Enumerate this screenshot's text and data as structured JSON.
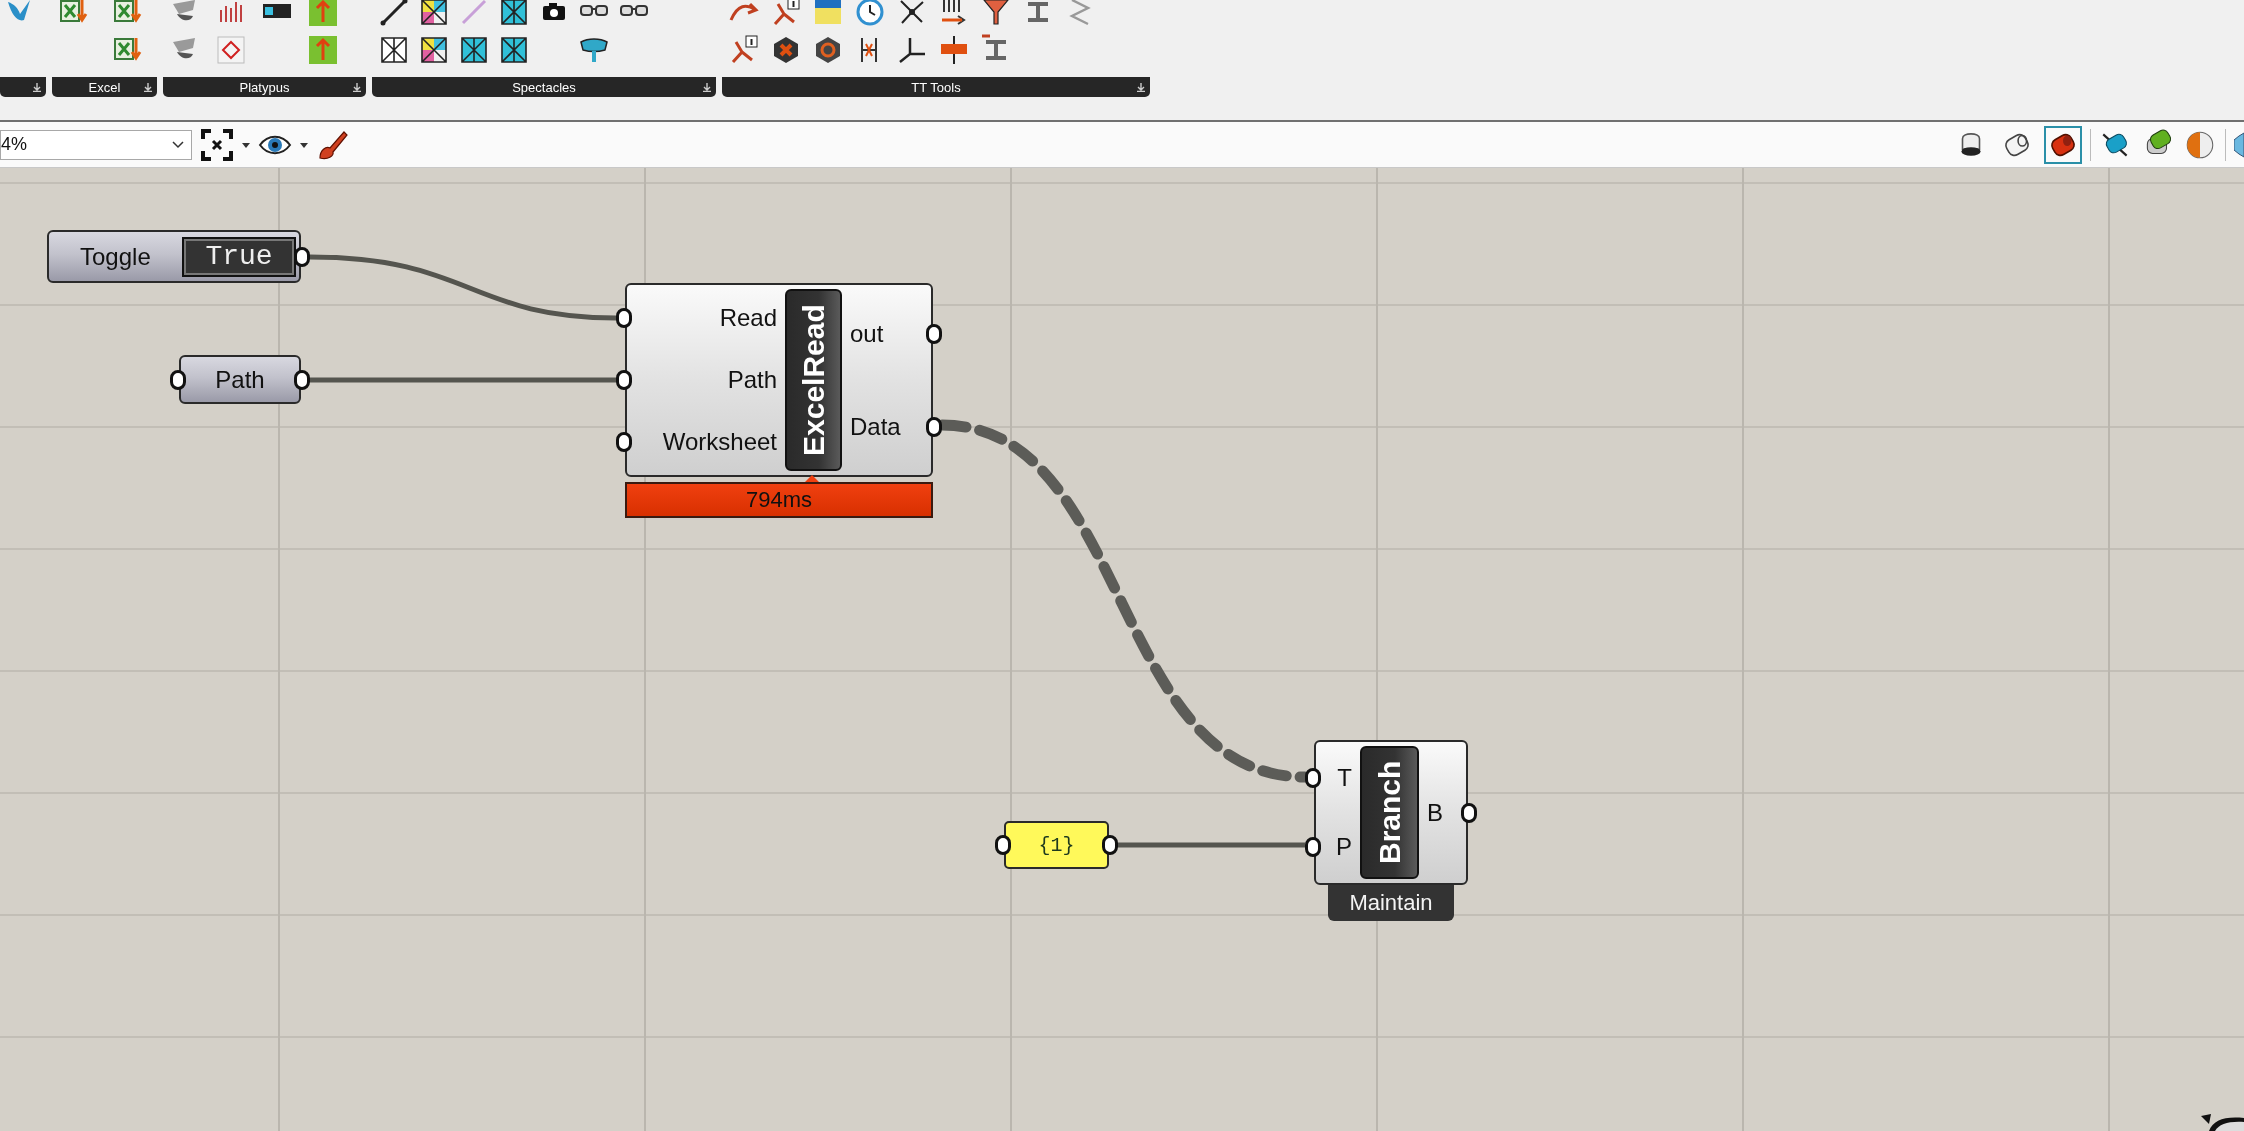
{
  "ribbon": {
    "groups": [
      {
        "label": "Excel"
      },
      {
        "label": "Platypus"
      },
      {
        "label": "Spectacles"
      },
      {
        "label": "TT Tools"
      }
    ]
  },
  "toolbar": {
    "zoom": {
      "value": "4%"
    },
    "display_modes": [
      {
        "selected": false
      },
      {
        "selected": false
      },
      {
        "selected": true
      }
    ]
  },
  "canvas": {
    "nodes": [
      {
        "kind": "toggle",
        "label": "Toggle",
        "value": "True"
      },
      {
        "kind": "param",
        "label": "Path"
      },
      {
        "kind": "component",
        "name": "ExcelRead",
        "inputs": [
          "Read",
          "Path",
          "Worksheet"
        ],
        "outputs": [
          "out",
          "Data"
        ],
        "profiler": "794ms"
      },
      {
        "kind": "panel",
        "text": "{1}"
      },
      {
        "kind": "component",
        "name": "Branch",
        "inputs": [
          "T",
          "P"
        ],
        "outputs": [
          "B"
        ],
        "tag": "Maintain"
      }
    ]
  }
}
